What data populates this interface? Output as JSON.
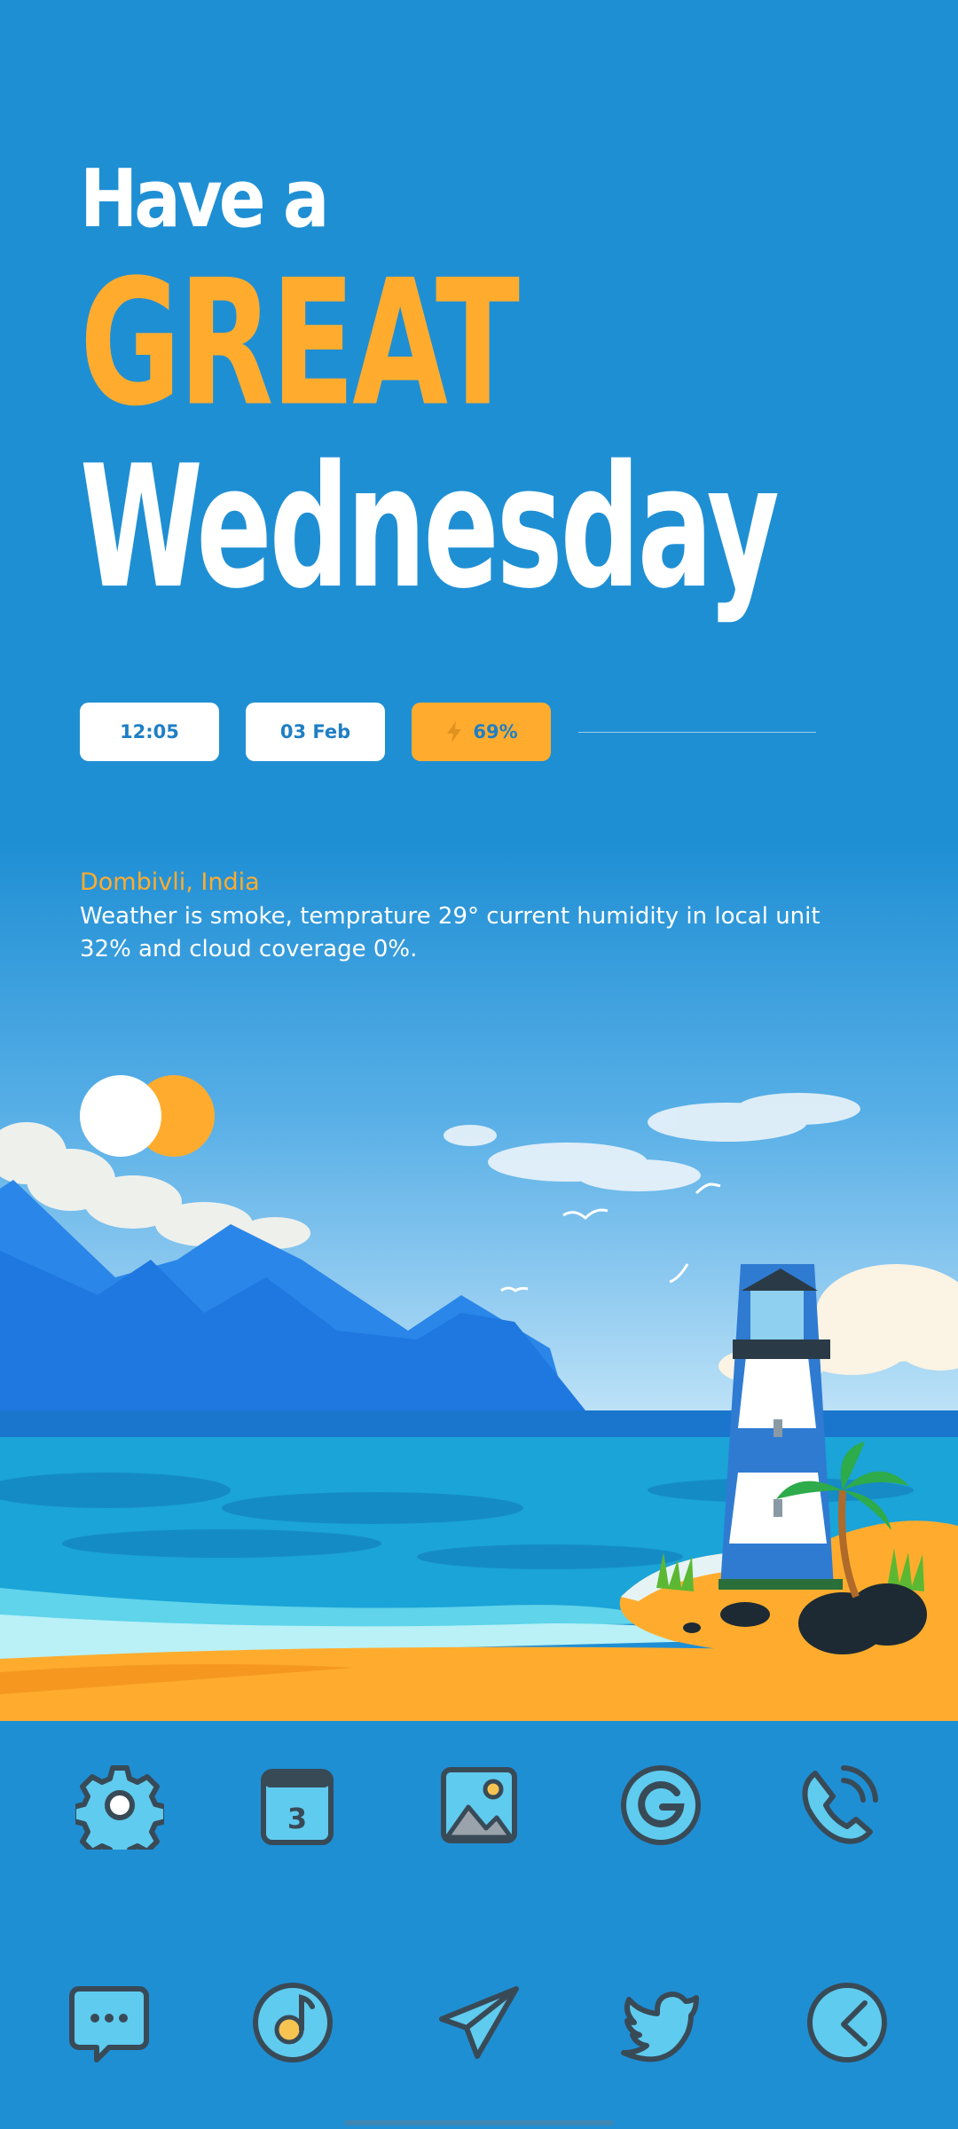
{
  "greeting": {
    "line1": "Have a",
    "line2": "GREAT",
    "line3": "Wednesday"
  },
  "info_chips": {
    "time": "12:05",
    "date": "03 Feb",
    "battery": "69%"
  },
  "weather": {
    "location": "Dombivli, India",
    "description": "Weather is smoke, temprature 29° current humidity in local unit 32% and cloud coverage 0%."
  },
  "colors": {
    "background": "#1f8fd4",
    "accent": "#ffac2e",
    "icon_fill": "#5fcbef",
    "icon_stroke": "#394a57"
  },
  "apps_row1": [
    {
      "icon": "settings-icon"
    },
    {
      "icon": "calendar-icon",
      "badge": "3"
    },
    {
      "icon": "gallery-icon"
    },
    {
      "icon": "google-icon"
    },
    {
      "icon": "phone-icon"
    }
  ],
  "apps_row2": [
    {
      "icon": "messages-icon"
    },
    {
      "icon": "music-icon"
    },
    {
      "icon": "telegram-icon"
    },
    {
      "icon": "twitter-icon"
    },
    {
      "icon": "clock-icon"
    }
  ]
}
